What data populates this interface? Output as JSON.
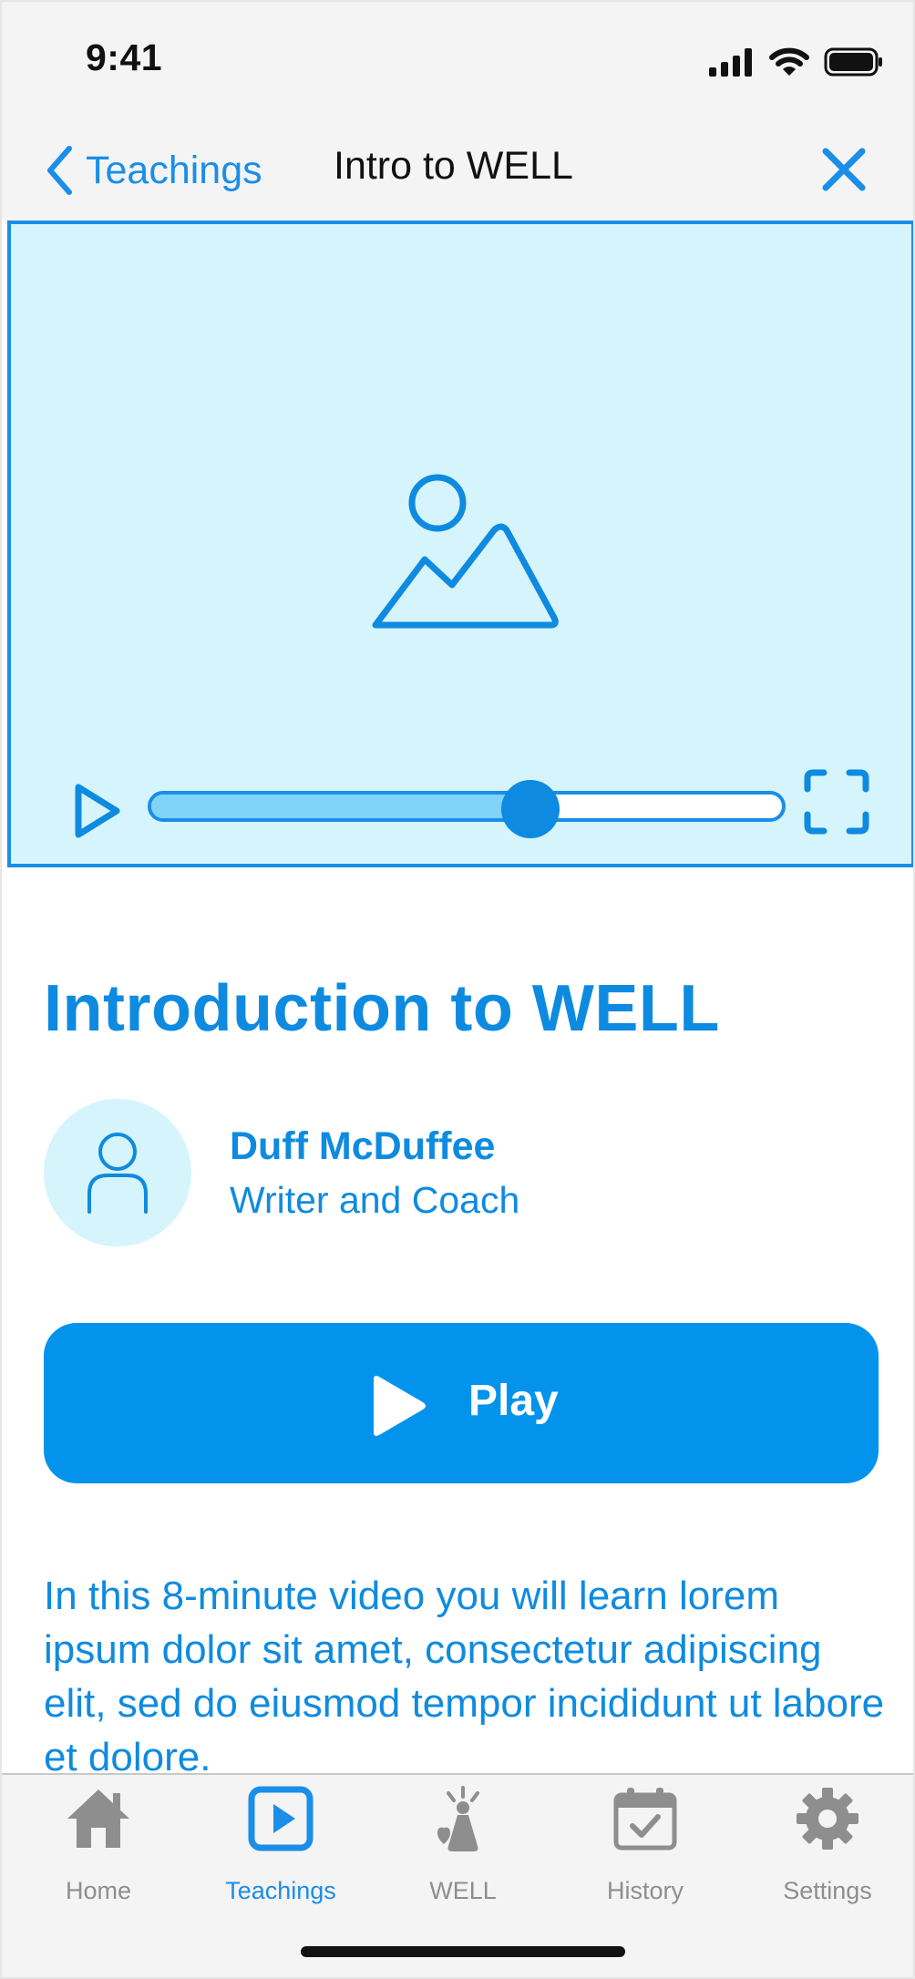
{
  "status_bar": {
    "time": "9:41"
  },
  "nav": {
    "back_label": "Teachings",
    "title": "Intro to WELL"
  },
  "video": {
    "progress": 0.6
  },
  "lesson": {
    "title": "Introduction to WELL",
    "author_name": "Duff McDuffee",
    "author_role": "Writer and Coach",
    "play_label": "Play",
    "description": "In this 8-minute video you will learn lorem ipsum dolor sit amet, consectetur adipiscing elit, sed do eiusmod tempor incididunt ut labore et dolore."
  },
  "tabs": [
    {
      "label": "Home",
      "icon": "home-icon",
      "active": false
    },
    {
      "label": "Teachings",
      "icon": "teachings-play-icon",
      "active": true
    },
    {
      "label": "WELL",
      "icon": "well-icon",
      "active": false
    },
    {
      "label": "History",
      "icon": "calendar-check-icon",
      "active": false
    },
    {
      "label": "Settings",
      "icon": "gear-icon",
      "active": false
    }
  ],
  "colors": {
    "accent": "#0e8be0",
    "play_button": "#0393ec",
    "video_bg": "#d6f4fc",
    "scrubber_fill": "#7fd4f7",
    "tab_inactive": "#8e8e8e",
    "bar_bg": "#f4f4f4"
  }
}
